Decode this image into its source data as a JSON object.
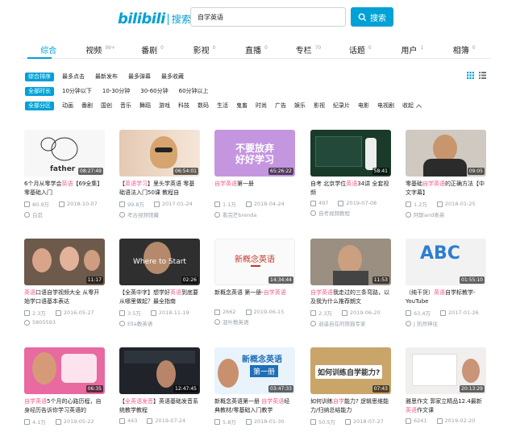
{
  "header": {
    "brand": "bilibili",
    "search_word": "搜索",
    "search_value": "自学英语",
    "search_button": "搜索"
  },
  "tabs": [
    {
      "label": "综合",
      "count": ""
    },
    {
      "label": "视频",
      "count": "99+"
    },
    {
      "label": "番剧",
      "count": "0"
    },
    {
      "label": "影视",
      "count": "0"
    },
    {
      "label": "直播",
      "count": "0"
    },
    {
      "label": "专栏",
      "count": "70"
    },
    {
      "label": "话题",
      "count": "0"
    },
    {
      "label": "用户",
      "count": "1"
    },
    {
      "label": "相簿",
      "count": "0"
    }
  ],
  "filters": {
    "order": {
      "active": "综合排序",
      "options": [
        "最多点击",
        "最新发布",
        "最多弹幕",
        "最多收藏"
      ]
    },
    "duration": {
      "active": "全部时长",
      "options": [
        "10分钟以下",
        "10-30分钟",
        "30-60分钟",
        "60分钟以上"
      ]
    },
    "zone": {
      "active": "全部分区",
      "options": [
        "动画",
        "番剧",
        "国创",
        "音乐",
        "舞蹈",
        "游戏",
        "科技",
        "数码",
        "生活",
        "鬼畜",
        "时尚",
        "广告",
        "娱乐",
        "影视",
        "纪录片",
        "电影",
        "电视剧",
        "收起"
      ]
    }
  },
  "videos": [
    {
      "dur": "08:27:49",
      "title_pre": "6个月从零学会",
      "hl": "英语",
      "title_post": "【69全集】零基础入门",
      "views": "80.9万",
      "date": "2018-10-07",
      "uploader": "白忍"
    },
    {
      "dur": "06:54:01",
      "title_pre": "【",
      "hl": "英语学习",
      "title_post": "】里头学英语 零基础语法入门50课 教程自",
      "views": "99.8万",
      "date": "2017-01-24",
      "uploader": "考古视频馆藏"
    },
    {
      "dur": "65:26:22",
      "title_pre": "",
      "hl": "自学英语",
      "title_post": "第一册",
      "views": "1.1万",
      "date": "2018-04-24",
      "uploader": "看完芒brenda"
    },
    {
      "dur": "58:41",
      "title_pre": "自考 北京学位",
      "hl": "英语",
      "title_post": "34讲 全套视频",
      "views": "497",
      "date": "2019-07-08",
      "uploader": "自考视频教程"
    },
    {
      "dur": "09:05",
      "title_pre": "零基础",
      "hl": "自学英语",
      "title_post": "的正确方法【中文字幕】",
      "views": "1.2万",
      "date": "2018-01-25",
      "uploader": "阿斯and表弟"
    },
    {
      "dur": "11:17",
      "title_pre": "",
      "hl": "英语",
      "title_post": "口语自学视频大全 从零开始学口语基本表达",
      "views": "2.3万",
      "date": "2016-05-27",
      "uploader": "5805593"
    },
    {
      "dur": "02:26",
      "title_pre": "【全英中字】想学好",
      "hl": "英语",
      "title_post": "到底要从哪里做起？最全指南",
      "views": "3.5万",
      "date": "2018-11-19",
      "uploader": "Ella教英语"
    },
    {
      "dur": "14:34:44",
      "title_pre": "新概念英语 第一册-",
      "hl": "自学英语",
      "title_post": "",
      "views": "2662",
      "date": "2019-06-15",
      "uploader": "混叶教英语"
    },
    {
      "dur": "11:53",
      "title_pre": "",
      "hl": "自学英语",
      "title_post": "我走过的三条弯路，以及我为什么推荐朗文",
      "views": "2.3万",
      "date": "2019-06-20",
      "uploader": "逍遥自在的熊猫专家"
    },
    {
      "dur": "01:55:10",
      "title_pre": "（纯干货）",
      "hl": "英语",
      "title_post": "自学标教学-YouTube",
      "views": "63.4万",
      "date": "2017-01-26",
      "uploader": "J 凯然神往"
    },
    {
      "dur": "06:35",
      "title_pre": "",
      "hl": "自学英语",
      "title_post": "5个月的心路历程，自身经历告诉你学习英语的",
      "views": "4.1万",
      "date": "2019-05-22",
      "uploader": ""
    },
    {
      "dur": "12:47:45",
      "title_pre": "【",
      "hl": "全英语发音",
      "title_post": "】英语基础发音系统教学教程",
      "views": "443",
      "date": "2019-07-24",
      "uploader": ""
    },
    {
      "dur": "03:47:33",
      "title_pre": "新概念英语第一册 ",
      "hl": "自学英语",
      "title_post": "经典教材/零基础入门教学",
      "views": "5.8万",
      "date": "2018-01-30",
      "uploader": ""
    },
    {
      "dur": "07:43",
      "title_pre": "如何训练",
      "hl": "自学",
      "title_post": "能力? 逻辑思维能力/归纳总结能力",
      "views": "50.5万",
      "date": "2018-07-27",
      "uploader": ""
    },
    {
      "dur": "20:13:29",
      "title_pre": "雅思作文 郭家立精品12.4最新 ",
      "hl": "英语",
      "title_post": "作文课",
      "views": "6241",
      "date": "2019-02-20",
      "uploader": ""
    }
  ],
  "thumb_text": {
    "t1": "father",
    "t3a": "不要放弃",
    "t3b": "好好学习",
    "t7": "Where to Start",
    "t8": "新概念英语",
    "t13a": "新概念英语",
    "t13b": "第一册",
    "t14": "如何训练自学能力?",
    "t10": "ABC"
  },
  "colors": {
    "accent": "#00a1d6",
    "highlight": "#f25d8e",
    "meta": "#99a2aa"
  }
}
